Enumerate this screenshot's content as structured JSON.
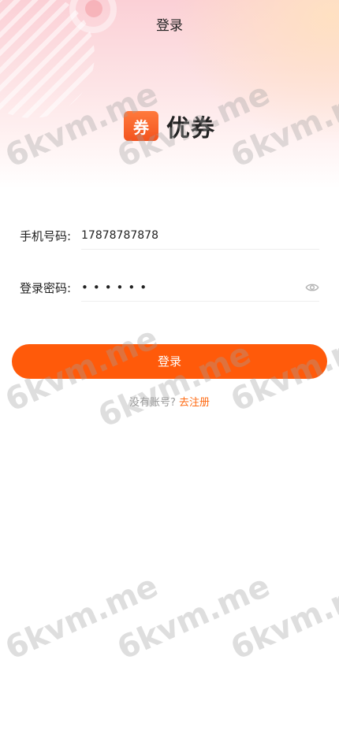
{
  "header": {
    "title": "登录"
  },
  "brand": {
    "icon_char": "券",
    "name": "优券"
  },
  "form": {
    "phone_label": "手机号码:",
    "phone_value": "17878787878",
    "password_label": "登录密码:",
    "password_masked": "••••••",
    "password_toggle_icon": "eye-icon"
  },
  "login_button": {
    "label": "登录"
  },
  "register": {
    "prompt": "没有账号?",
    "link_label": "去注册"
  },
  "watermark": {
    "text": "6kvm.me"
  },
  "colors": {
    "accent": "#ff5a0a",
    "link": "#ff6a12",
    "brand_icon": "#f3531e"
  }
}
